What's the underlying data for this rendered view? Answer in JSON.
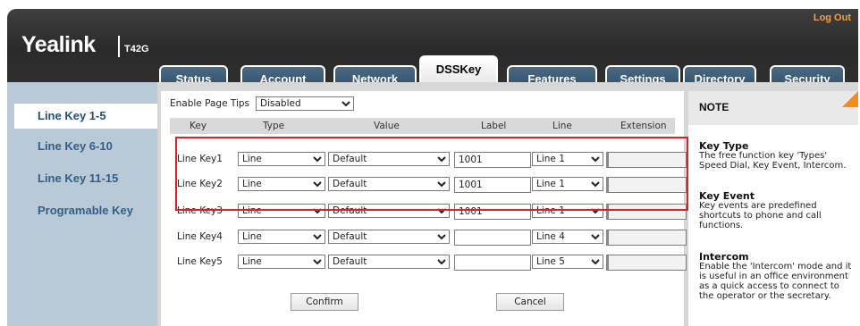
{
  "header": {
    "brand": "Yealink",
    "model": "T42G",
    "logout_label": "Log Out"
  },
  "tabs": [
    {
      "label": "Status"
    },
    {
      "label": "Account"
    },
    {
      "label": "Network"
    },
    {
      "label": "DSSKey",
      "active": true
    },
    {
      "label": "Features"
    },
    {
      "label": "Settings"
    },
    {
      "label": "Directory"
    },
    {
      "label": "Security"
    }
  ],
  "sidebar": {
    "items": [
      {
        "label": "Line Key 1-5",
        "active": true
      },
      {
        "label": "Line Key 6-10"
      },
      {
        "label": "Line Key 11-15"
      },
      {
        "label": "Programable Key"
      }
    ]
  },
  "main": {
    "page_tips_label": "Enable Page Tips",
    "page_tips_value": "Disabled",
    "columns": [
      "Key",
      "Type",
      "Value",
      "Label",
      "Line",
      "Extension"
    ],
    "rows": [
      {
        "key": "Line Key1",
        "type": "Line",
        "value": "Default",
        "label": "1001",
        "line": "Line 1",
        "extension": ""
      },
      {
        "key": "Line Key2",
        "type": "Line",
        "value": "Default",
        "label": "1001",
        "line": "Line 1",
        "extension": ""
      },
      {
        "key": "Line Key3",
        "type": "Line",
        "value": "Default",
        "label": "1001",
        "line": "Line 1",
        "extension": ""
      },
      {
        "key": "Line Key4",
        "type": "Line",
        "value": "Default",
        "label": "",
        "line": "Line 4",
        "extension": ""
      },
      {
        "key": "Line Key5",
        "type": "Line",
        "value": "Default",
        "label": "",
        "line": "Line 5",
        "extension": ""
      }
    ],
    "confirm_label": "Confirm",
    "cancel_label": "Cancel"
  },
  "note": {
    "title": "NOTE",
    "sections": [
      {
        "heading": "Key Type",
        "text": "The free function key 'Types' Speed Dial, Key Event, Intercom."
      },
      {
        "heading": "Key Event",
        "text": "Key events are predefined shortcuts to phone and call functions."
      },
      {
        "heading": "Intercom",
        "text": "Enable the 'Intercom' mode and it is useful in an office environment as a quick access to connect to the operator or the secretary."
      }
    ]
  },
  "colors": {
    "accent": "#f28c1e",
    "highlight": "#e02020",
    "nav_text": "#2f5f8a"
  }
}
